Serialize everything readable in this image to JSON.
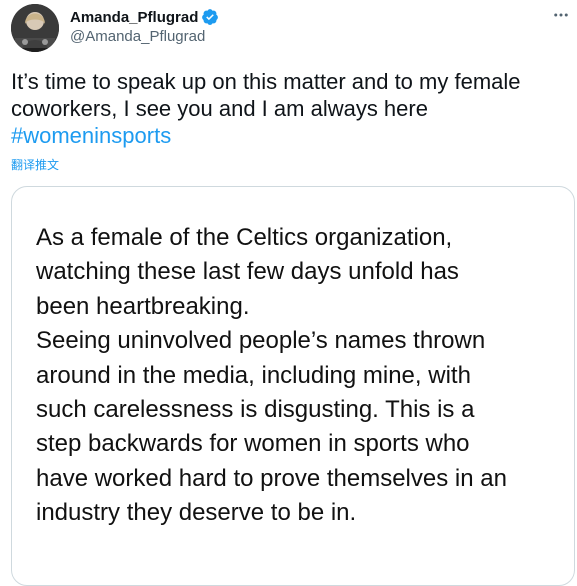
{
  "user": {
    "display_name": "Amanda_Pflugrad",
    "handle": "@Amanda_Pflugrad",
    "verified": true,
    "verified_color": "#1d9bf0"
  },
  "tweet": {
    "text_line_1": "It’s time to speak up on this matter  and to my female",
    "text_line_2": "coworkers, I see you and I am always here",
    "hashtag": "#womeninsports",
    "translate_label": "翻译推文"
  },
  "media": {
    "lines": [
      "As a female of the Celtics organization,",
      "watching these last few days unfold has",
      "been heartbreaking.",
      "Seeing uninvolved people’s names thrown",
      "around in the media, including mine, with",
      "such carelessness is disgusting. This is a",
      "step backwards for women in sports who",
      "have worked hard to prove themselves in an",
      "industry they deserve to be in."
    ]
  },
  "icons": {
    "avatar": "avatar-photo",
    "verified": "verified-badge-icon",
    "more": "more-options-icon"
  },
  "colors": {
    "link": "#1d9bf0",
    "text": "#0f1419",
    "secondary": "#536471",
    "border": "#cfd9de"
  }
}
